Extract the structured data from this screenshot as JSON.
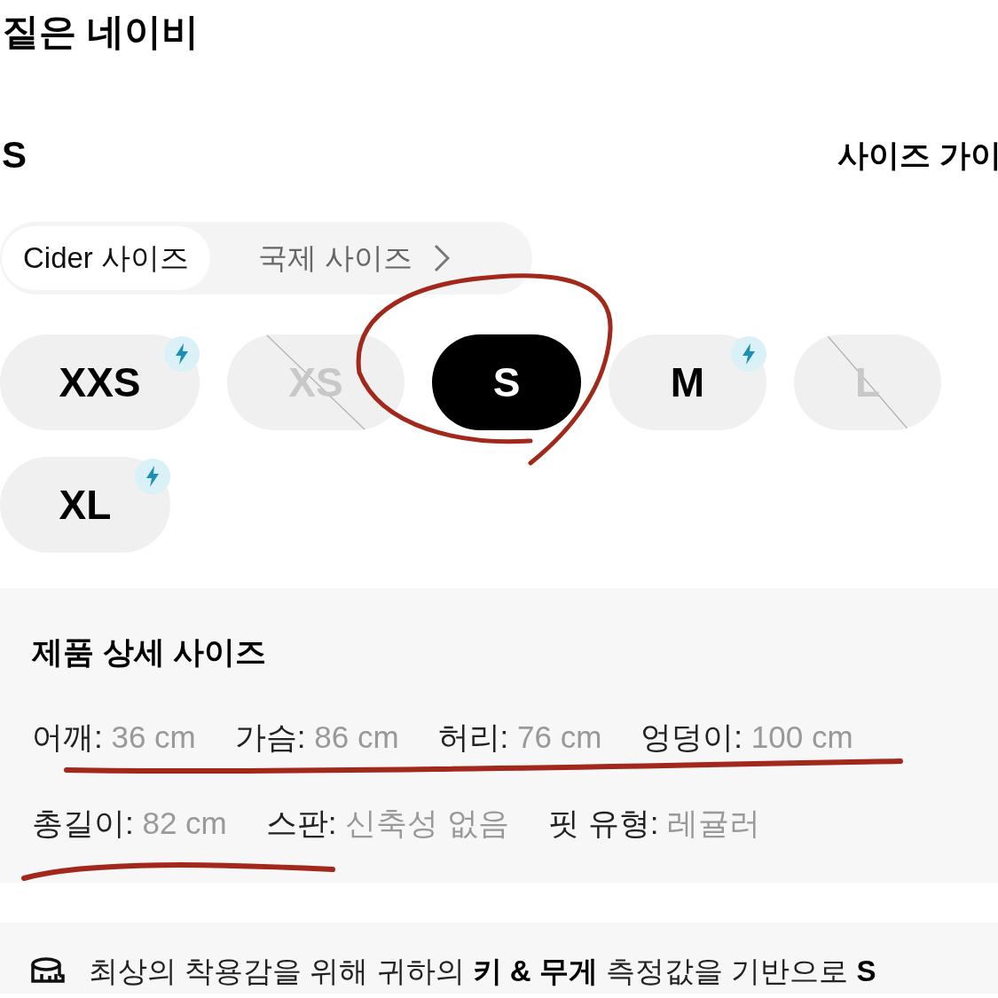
{
  "color_name": "짙은 네이비",
  "size_header": {
    "selected_size": "S",
    "guide_link": "사이즈 가이"
  },
  "size_tabs": [
    {
      "label": "Cider 사이즈",
      "selected": true,
      "chevron": false
    },
    {
      "label": "국제 사이즈",
      "selected": false,
      "chevron": true
    }
  ],
  "sizes": [
    {
      "label": "XXS",
      "selected": false,
      "available": true,
      "fast_shipping": true
    },
    {
      "label": "XS",
      "selected": false,
      "available": false,
      "fast_shipping": false
    },
    {
      "label": "S",
      "selected": true,
      "available": true,
      "fast_shipping": false
    },
    {
      "label": "M",
      "selected": false,
      "available": true,
      "fast_shipping": true
    },
    {
      "label": "L",
      "selected": false,
      "available": false,
      "fast_shipping": false
    },
    {
      "label": "XL",
      "selected": false,
      "available": true,
      "fast_shipping": true
    }
  ],
  "details": {
    "title": "제품 상세 사이즈",
    "rows": [
      [
        {
          "label": "어깨:",
          "value": "36 cm"
        },
        {
          "label": "가슴:",
          "value": "86 cm"
        },
        {
          "label": "허리:",
          "value": "76 cm"
        },
        {
          "label": "엉덩이:",
          "value": "100 cm"
        }
      ],
      [
        {
          "label": "총길이:",
          "value": "82 cm"
        },
        {
          "label": "스판:",
          "value": "신축성 없음"
        },
        {
          "label": "핏 유형:",
          "value": "레귤러"
        }
      ]
    ]
  },
  "recommendation": {
    "text": "최상의 착용감을 위해 귀하의 **키 & 무게** 측정값을 기반으로 **S**"
  }
}
